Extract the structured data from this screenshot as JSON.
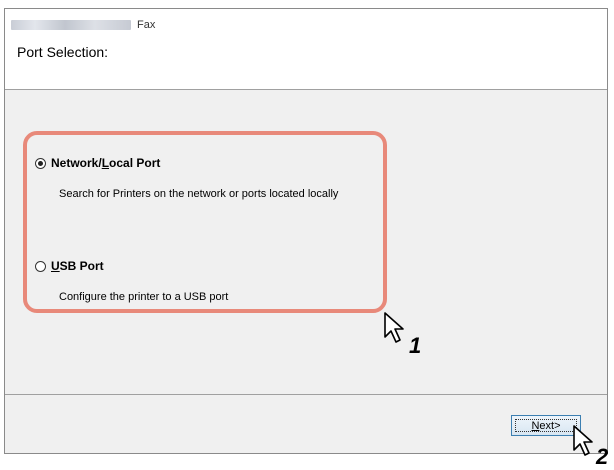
{
  "window": {
    "title": "Fax",
    "heading": "Port Selection:"
  },
  "options": [
    {
      "label_pre": "Network/",
      "label_underline": "L",
      "label_post": "ocal Port",
      "description": "Search for Printers on the network or ports located locally",
      "selected": true
    },
    {
      "label_pre": "",
      "label_underline": "U",
      "label_post": "SB Port",
      "description": "Configure the printer to a USB port",
      "selected": false
    }
  ],
  "footer": {
    "next_label_underline": "N",
    "next_label_post": "ext>"
  },
  "callouts": {
    "step1": "1",
    "step2": "2"
  },
  "colors": {
    "highlight": "#e8897a",
    "button_border": "#3c7fb1"
  },
  "icons": {
    "cursor": "arrow-cursor-icon"
  }
}
